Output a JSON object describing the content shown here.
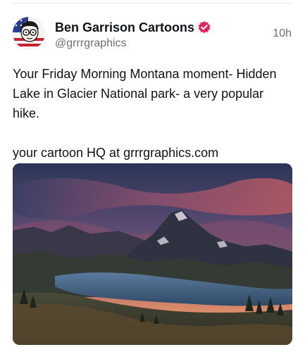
{
  "author": {
    "display_name": "Ben Garrison Cartoons",
    "handle": "@grrrgraphics",
    "avatar_icon": "cartoon-avatar-icon",
    "verified_icon": "verified-badge-icon",
    "verified_color": "#e0245e"
  },
  "post": {
    "timestamp": "10h",
    "text_line1": "Your Friday Morning Montana moment- Hidden Lake in Glacier National park- a very popular hike.",
    "text_line2": "your cartoon HQ at grrrgraphics.com"
  },
  "media": {
    "image_icon": "mountain-lake-photo"
  },
  "colors": {
    "text": "#0f1419",
    "muted": "#6b7075",
    "divider": "#e6e8ea"
  }
}
